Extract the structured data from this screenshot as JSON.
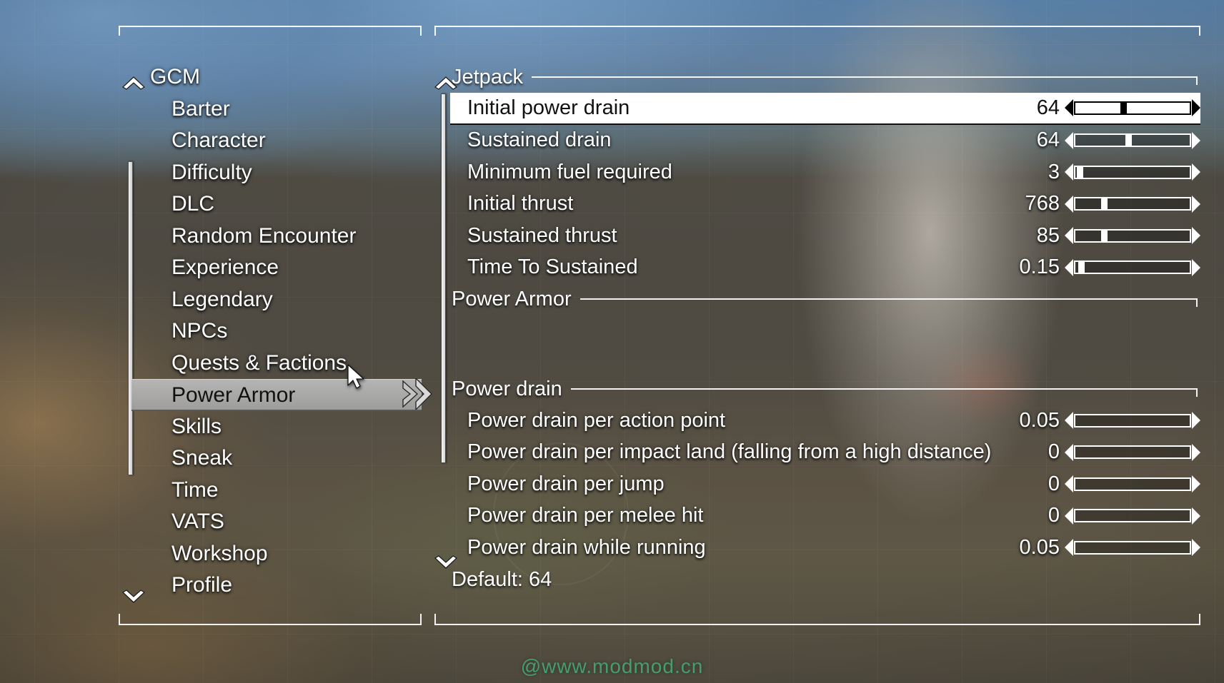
{
  "sidebar": {
    "root_label": "GCM",
    "up_icon": "chevron-up-icon",
    "down_icon": "chevron-down-icon",
    "items": [
      {
        "label": "Barter",
        "selected": false
      },
      {
        "label": "Character",
        "selected": false
      },
      {
        "label": "Difficulty",
        "selected": false
      },
      {
        "label": "DLC",
        "selected": false
      },
      {
        "label": "Random Encounter",
        "selected": false
      },
      {
        "label": "Experience",
        "selected": false
      },
      {
        "label": "Legendary",
        "selected": false
      },
      {
        "label": "NPCs",
        "selected": false
      },
      {
        "label": "Quests & Factions",
        "selected": false
      },
      {
        "label": "Power Armor",
        "selected": true
      },
      {
        "label": "Skills",
        "selected": false
      },
      {
        "label": "Sneak",
        "selected": false
      },
      {
        "label": "Time",
        "selected": false
      },
      {
        "label": "VATS",
        "selected": false
      },
      {
        "label": "Workshop",
        "selected": false
      },
      {
        "label": "Profile",
        "selected": false
      }
    ]
  },
  "settings": {
    "up_icon": "chevron-up-icon",
    "down_icon": "chevron-down-icon",
    "sections": [
      {
        "kind": "section",
        "title": "Jetpack",
        "rows": [
          {
            "label": "Initial power drain",
            "value": "64",
            "fill": 0.42,
            "selected": true
          },
          {
            "label": "Sustained drain",
            "value": "64",
            "fill": 0.46,
            "selected": false
          },
          {
            "label": "Minimum fuel required",
            "value": "3",
            "fill": 0.04,
            "selected": false
          },
          {
            "label": "Initial thrust",
            "value": "768",
            "fill": 0.25,
            "selected": false
          },
          {
            "label": "Sustained thrust",
            "value": "85",
            "fill": 0.25,
            "selected": false
          },
          {
            "label": "Time To Sustained",
            "value": "0.15",
            "fill": 0.05,
            "selected": false
          }
        ]
      },
      {
        "kind": "section",
        "title": "Power Armor",
        "rows": []
      },
      {
        "kind": "section",
        "title": "Power drain",
        "rows": [
          {
            "label": "Power drain per action point",
            "value": "0.05",
            "fill": 0.0,
            "selected": false
          },
          {
            "label": "Power drain per impact land (falling from a high distance)",
            "value": "0",
            "fill": 0.0,
            "selected": false
          },
          {
            "label": "Power drain per jump",
            "value": "0",
            "fill": 0.0,
            "selected": false
          },
          {
            "label": "Power drain per melee hit",
            "value": "0",
            "fill": 0.0,
            "selected": false
          },
          {
            "label": "Power drain while running",
            "value": "0.05",
            "fill": 0.0,
            "selected": false
          }
        ]
      }
    ],
    "default_hint": "Default: 64"
  },
  "watermark": "@www.modmod.cn",
  "colors": {
    "frame": "#ffffff",
    "selected_row_bg": "#ffffff",
    "sidebar_selected_bg": "#bababa",
    "watermark": "#3fbf7f"
  }
}
